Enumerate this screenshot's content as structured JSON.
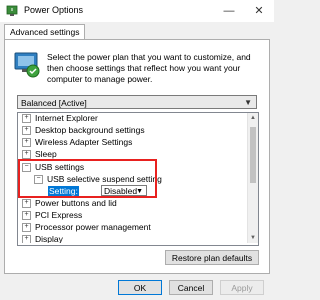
{
  "window": {
    "title": "Power Options",
    "minimize_glyph": "—",
    "close_glyph": "✕",
    "app_icon": "power-options-icon"
  },
  "tabs": [
    {
      "label": "Advanced settings",
      "selected": true
    }
  ],
  "panel": {
    "description": "Select the power plan that you want to customize, and then choose settings that reflect how you want your computer to manage power.",
    "plan_select": {
      "value": "Balanced [Active]"
    }
  },
  "tree": {
    "items": [
      {
        "label": "Internet Explorer",
        "expander": "+"
      },
      {
        "label": "Desktop background settings",
        "expander": "+"
      },
      {
        "label": "Wireless Adapter Settings",
        "expander": "+"
      },
      {
        "label": "Sleep",
        "expander": "+"
      },
      {
        "label": "USB settings",
        "expander": "−"
      },
      {
        "label": "USB selective suspend setting",
        "expander": "−"
      },
      {
        "label": "Setting:",
        "value": "Disabled"
      },
      {
        "label": "Power buttons and lid",
        "expander": "+"
      },
      {
        "label": "PCI Express",
        "expander": "+"
      },
      {
        "label": "Processor power management",
        "expander": "+"
      },
      {
        "label": "Display",
        "expander": "+"
      }
    ]
  },
  "buttons": {
    "restore": "Restore plan defaults",
    "ok": "OK",
    "cancel": "Cancel",
    "apply": "Apply"
  },
  "colors": {
    "highlight_border": "#e8211f",
    "selection": "#0078d7"
  }
}
